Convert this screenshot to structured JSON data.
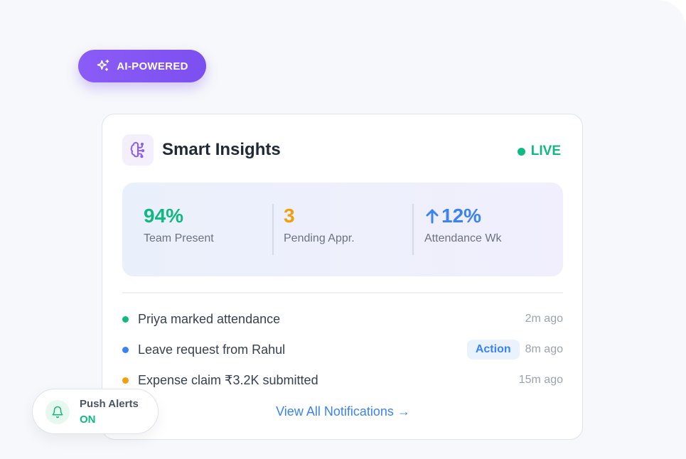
{
  "badge": {
    "label": "AI-POWERED",
    "icon": "sparkles-icon"
  },
  "card": {
    "icon": "brain-icon",
    "title": "Smart Insights",
    "status": "LIVE",
    "stats": [
      {
        "value": "94%",
        "label": "Team Present",
        "color": "#10b981"
      },
      {
        "value": "3",
        "label": "Pending Appr.",
        "color": "#f59e0b"
      },
      {
        "value": "12%",
        "label": "Attendance Wk",
        "color": "#3b82f6",
        "icon": "arrow-up-icon"
      }
    ],
    "notifications": [
      {
        "text": "Priya marked attendance",
        "time": "2m ago",
        "color": "#10b981"
      },
      {
        "text": "Leave request from Rahul",
        "time": "8m ago",
        "color": "#3b82f6",
        "action": "Action"
      },
      {
        "text": "Expense claim ₹3.2K submitted",
        "time": "15m ago",
        "color": "#f59e0b"
      }
    ],
    "view_all": "View All Notifications →"
  },
  "push": {
    "label": "Push Alerts",
    "state": "ON",
    "icon": "bell-icon"
  }
}
